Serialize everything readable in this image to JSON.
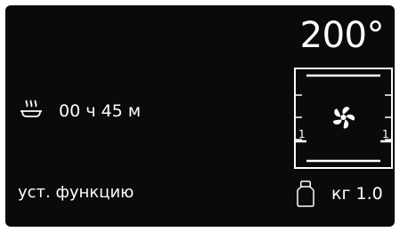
{
  "temperature": "200°",
  "timer": {
    "value": "00 ч 45 м",
    "icon": "steam-dish-icon"
  },
  "oven": {
    "icon": "fan-icon",
    "left_level": "1",
    "right_level": "1"
  },
  "prompt": "уст. функцию",
  "weight": {
    "value": "кг 1.0",
    "icon": "weight-icon"
  },
  "colors": {
    "background": "#0a0a0a",
    "foreground": "#ffffff"
  }
}
